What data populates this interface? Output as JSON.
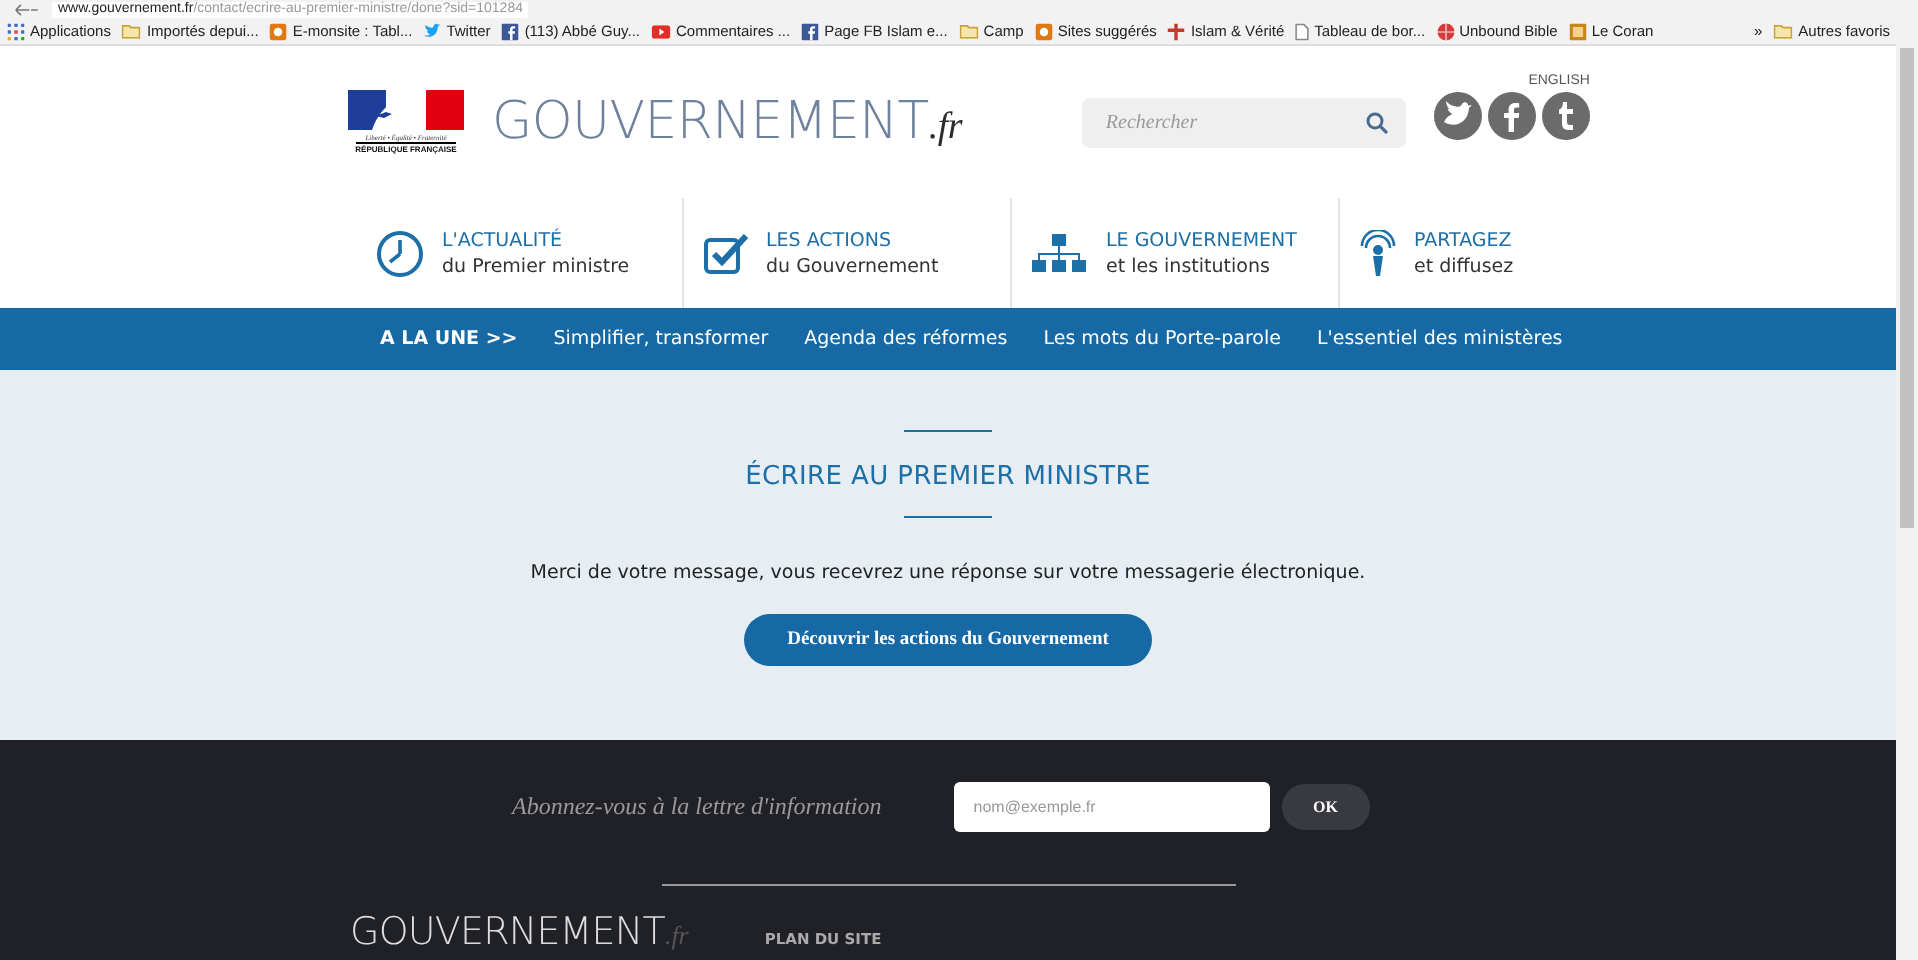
{
  "browser": {
    "url_host": "www.gouvernement.fr",
    "url_path": "/contact/ecrire-au-premier-ministre/done?sid=101284",
    "bookmarks": [
      {
        "label": "Applications",
        "kind": "apps"
      },
      {
        "label": "Importés depui...",
        "kind": "folder"
      },
      {
        "label": "E-monsite : Tabl...",
        "kind": "site"
      },
      {
        "label": "Twitter",
        "kind": "twitter"
      },
      {
        "label": "(113) Abbé Guy...",
        "kind": "facebook"
      },
      {
        "label": "Commentaires ...",
        "kind": "youtube"
      },
      {
        "label": "Page FB Islam e...",
        "kind": "facebook"
      },
      {
        "label": "Camp",
        "kind": "folder"
      },
      {
        "label": "Sites suggérés",
        "kind": "site"
      },
      {
        "label": "Islam & Vérité",
        "kind": "cross"
      },
      {
        "label": "Tableau de bor...",
        "kind": "page"
      },
      {
        "label": "Unbound Bible",
        "kind": "globe"
      },
      {
        "label": "Le Coran",
        "kind": "book"
      }
    ],
    "overflow": "»",
    "other": {
      "label": "Autres favoris",
      "kind": "folder"
    }
  },
  "header": {
    "logo_motto": "Liberté • Égalité • Fraternité",
    "logo_name": "RÉPUBLIQUE FRANÇAISE",
    "site_name": "GOUVERNEMENT",
    "site_suffix": ".fr",
    "search": {
      "placeholder": "Rechercher"
    },
    "language": "ENGLISH",
    "social": [
      {
        "kind": "twitter"
      },
      {
        "kind": "facebook"
      },
      {
        "kind": "tumblr"
      }
    ]
  },
  "features": [
    {
      "title": "L'ACTUALITÉ",
      "subtitle": "du Premier ministre",
      "kind": "clock"
    },
    {
      "title": "LES ACTIONS",
      "subtitle": "du Gouvernement",
      "kind": "check"
    },
    {
      "title": "LE GOUVERNEMENT",
      "subtitle": "et les institutions",
      "kind": "org"
    },
    {
      "title": "PARTAGEZ",
      "subtitle": "et diffusez",
      "kind": "broadcast"
    }
  ],
  "menu": {
    "heading": "A LA UNE >>",
    "links": [
      "Simplifier, transformer",
      "Agenda des réformes",
      "Les mots du Porte-parole",
      "L'essentiel des ministères"
    ]
  },
  "confirmation": {
    "title": "ÉCRIRE AU PREMIER MINISTRE",
    "message": "Merci de votre message, vous recevrez une réponse sur votre messagerie électronique.",
    "button": "Découvrir les actions du Gouvernement"
  },
  "footer": {
    "newsletter_label": "Abonnez-vous à la lettre d'information",
    "email": {
      "placeholder": "nom@exemple.fr"
    },
    "ok": "OK",
    "site_name": "GOUVERNEMENT",
    "site_suffix": ".fr",
    "sitemap": "PLAN DU SITE"
  }
}
